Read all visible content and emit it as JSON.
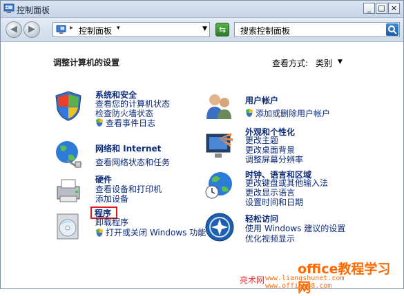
{
  "window": {
    "title": "控制面板",
    "min_label": "_",
    "max_label": "□",
    "close_label": "×"
  },
  "toolbar": {
    "back_glyph": "◀",
    "forward_glyph": "▶",
    "address_sep": "▸",
    "address_text": "控制面板",
    "address_drop": "▾",
    "address_arrow": "▼",
    "refresh_glyph": "⇆",
    "search_text": "搜索控制面板"
  },
  "main": {
    "heading": "调整计算机的设置",
    "view_label": "查看方式:",
    "view_value": "类别",
    "view_arrow": "▼"
  },
  "categories": {
    "system": {
      "title": "系统和安全",
      "links": [
        "查看您的计算机状态",
        "检查防火墙状态",
        "查看事件日志"
      ]
    },
    "network": {
      "title": "网络和 Internet",
      "links": [
        "查看网络状态和任务"
      ]
    },
    "hardware": {
      "title": "硬件",
      "links": [
        "查看设备和打印机",
        "添加设备"
      ]
    },
    "programs": {
      "title": "程序",
      "links": [
        "卸载程序",
        "打开或关闭 Windows 功能"
      ]
    },
    "users": {
      "title": "用户帐户",
      "links": [
        "添加或删除用户帐户"
      ]
    },
    "appearance": {
      "title": "外观和个性化",
      "links": [
        "更改主题",
        "更改桌面背景",
        "调整屏幕分辨率"
      ]
    },
    "clock": {
      "title": "时钟、语言和区域",
      "links": [
        "更改键盘或其他输入法",
        "更改显示语言",
        "设置时间和日期"
      ]
    },
    "ease": {
      "title": "轻松访问",
      "links": [
        "使用 Windows 建议的设置",
        "优化视频显示"
      ]
    }
  },
  "watermark": {
    "line1": "office教程学习网",
    "line2": "亮术网",
    "line3": "www.liangshunet.com  www.office68.com"
  },
  "icons": [
    "control-panel-icon",
    "shield-icon",
    "globe-icon",
    "printer-icon",
    "cd-icon",
    "users-icon",
    "monitor-icon",
    "clock-icon",
    "ease-icon",
    "search-icon"
  ]
}
